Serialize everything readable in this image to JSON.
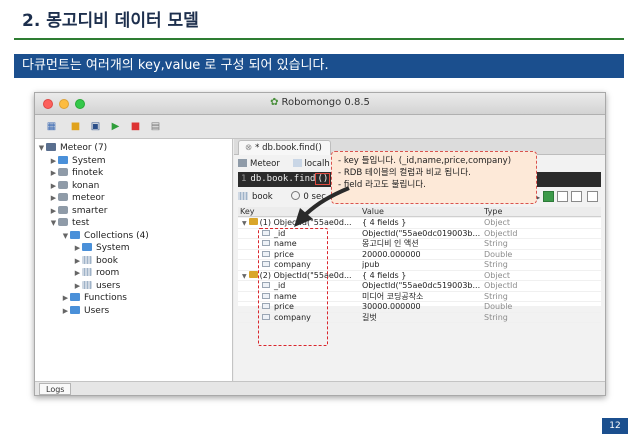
{
  "slide": {
    "title": "2. 몽고디비 데이터 모델",
    "banner": "다큐먼트는 여러개의 key,value 로 구성 되어 있습니다.",
    "page_number": "12"
  },
  "window": {
    "title": "Robomongo 0.8.5",
    "toolbar": {
      "icons": [
        "connect-icon",
        "open-folder-icon",
        "save-icon",
        "run-icon",
        "stop-icon",
        "extra-icon"
      ]
    }
  },
  "sidebar": {
    "items": [
      {
        "label": "Meteor (7)",
        "level": 0,
        "arrow": "▼",
        "icon": "server"
      },
      {
        "label": "System",
        "level": 1,
        "arrow": "▶",
        "icon": "folder"
      },
      {
        "label": "finotek",
        "level": 1,
        "arrow": "▶",
        "icon": "db"
      },
      {
        "label": "konan",
        "level": 1,
        "arrow": "▶",
        "icon": "db"
      },
      {
        "label": "meteor",
        "level": 1,
        "arrow": "▶",
        "icon": "db"
      },
      {
        "label": "smarter",
        "level": 1,
        "arrow": "▶",
        "icon": "db"
      },
      {
        "label": "test",
        "level": 1,
        "arrow": "▼",
        "icon": "db"
      },
      {
        "label": "Collections (4)",
        "level": 2,
        "arrow": "▼",
        "icon": "folder"
      },
      {
        "label": "System",
        "level": 3,
        "arrow": "▶",
        "icon": "folder"
      },
      {
        "label": "book",
        "level": 3,
        "arrow": "▶",
        "icon": "table"
      },
      {
        "label": "room",
        "level": 3,
        "arrow": "▶",
        "icon": "table"
      },
      {
        "label": "users",
        "level": 3,
        "arrow": "▶",
        "icon": "table"
      },
      {
        "label": "Functions",
        "level": 2,
        "arrow": "▶",
        "icon": "folder"
      },
      {
        "label": "Users",
        "level": 2,
        "arrow": "▶",
        "icon": "folder"
      }
    ]
  },
  "main": {
    "tab_label": "* db.book.find()",
    "connection": "Meteor",
    "host": "localh",
    "query_line_no": "1",
    "query_text": "db.book.find",
    "query_paren": "()",
    "collection": "book",
    "time": "0 sec.",
    "skip": "0",
    "limit": "50",
    "columns": {
      "key": "Key",
      "value": "Value",
      "type": "Type"
    },
    "rows": [
      {
        "key": "(1) ObjectId(\"55ae0d...",
        "value": "{ 4 fields }",
        "type": "Object",
        "depth": 1
      },
      {
        "key": "_id",
        "value": "ObjectId(\"55ae0dc019003b...",
        "type": "ObjectId",
        "depth": 2
      },
      {
        "key": "name",
        "value": "몽고디비 인 액션",
        "type": "String",
        "depth": 2
      },
      {
        "key": "price",
        "value": "20000.000000",
        "type": "Double",
        "depth": 2
      },
      {
        "key": "company",
        "value": "jpub",
        "type": "String",
        "depth": 2
      },
      {
        "key": "(2) ObjectId(\"55ae0d...",
        "value": "{ 4 fields }",
        "type": "Object",
        "depth": 1
      },
      {
        "key": "_id",
        "value": "ObjectId(\"55ae0dc519003b...",
        "type": "ObjectId",
        "depth": 2
      },
      {
        "key": "name",
        "value": "미디어 코딩공작소",
        "type": "String",
        "depth": 2
      },
      {
        "key": "price",
        "value": "30000.000000",
        "type": "Double",
        "depth": 2
      },
      {
        "key": "company",
        "value": "길벗",
        "type": "String",
        "depth": 2
      }
    ],
    "logs_label": "Logs"
  },
  "callout": {
    "lines": [
      "- key 들입니다. (_id,name,price,company)",
      "- RDB 테이블의 컬럼과 비교 됩니다.",
      "- field 라고도 불립니다."
    ]
  },
  "colors": {
    "banner": "#1b4f8e",
    "title_rule": "#2e7d32",
    "callout_fill": "#fde9d8",
    "callout_border": "#d9534f"
  }
}
